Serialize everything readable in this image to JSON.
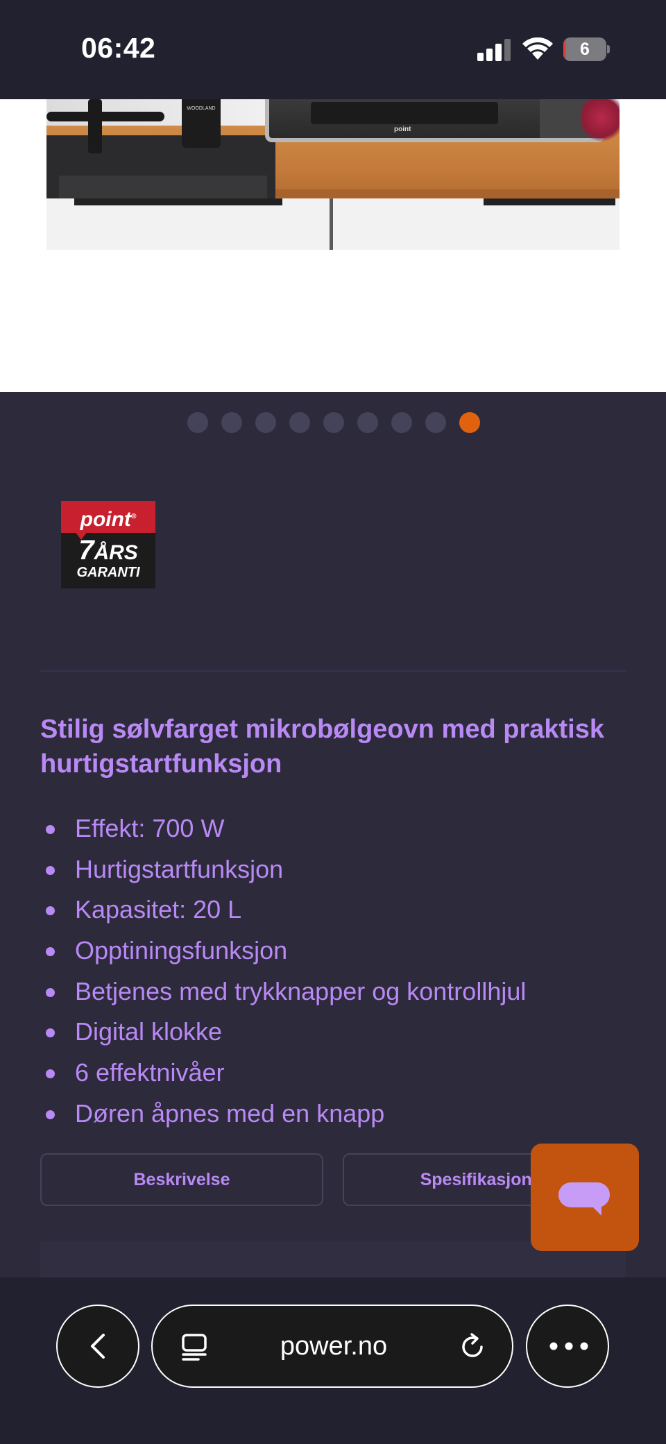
{
  "status_bar": {
    "time": "06:42",
    "battery_level": "6",
    "battery_fraction": 0.06,
    "signal_icon": "cellular-signal-icon",
    "wifi_icon": "wifi-icon"
  },
  "product_image": {
    "bottle_label": "WOODLAND",
    "microwave_logo": "point"
  },
  "carousel": {
    "total": 9,
    "active_index": 8,
    "dot_color": "#45435a",
    "active_color": "#e0620f"
  },
  "badge": {
    "brand": "point",
    "years": "7",
    "years_suffix": "ÅRS",
    "label": "GARANTI"
  },
  "product": {
    "headline": "Stilig sølvfarget mikrobølgeovn med praktisk hurtigstartfunksjon",
    "features": [
      "Effekt: 700 W",
      "Hurtigstartfunksjon",
      "Kapasitet: 20 L",
      "Opptiningsfunksjon",
      "Betjenes med trykknapper og kontrollhjul",
      "Digital klokke",
      "6 effektnivåer",
      "Døren åpnes med en knapp"
    ]
  },
  "tabs": {
    "description": "Beskrivelse",
    "specifications": "Spesifikasjoner"
  },
  "chat": {
    "icon": "chat-bubble-icon",
    "color": "#c2540f"
  },
  "browser": {
    "url": "power.no",
    "back_icon": "chevron-left-icon",
    "tabs_icon": "tabs-icon",
    "reload_icon": "reload-icon",
    "more_icon": "more-icon"
  },
  "colors": {
    "accent_text": "#b989f5",
    "background": "#2d2b3b",
    "bar_background": "#222130"
  }
}
